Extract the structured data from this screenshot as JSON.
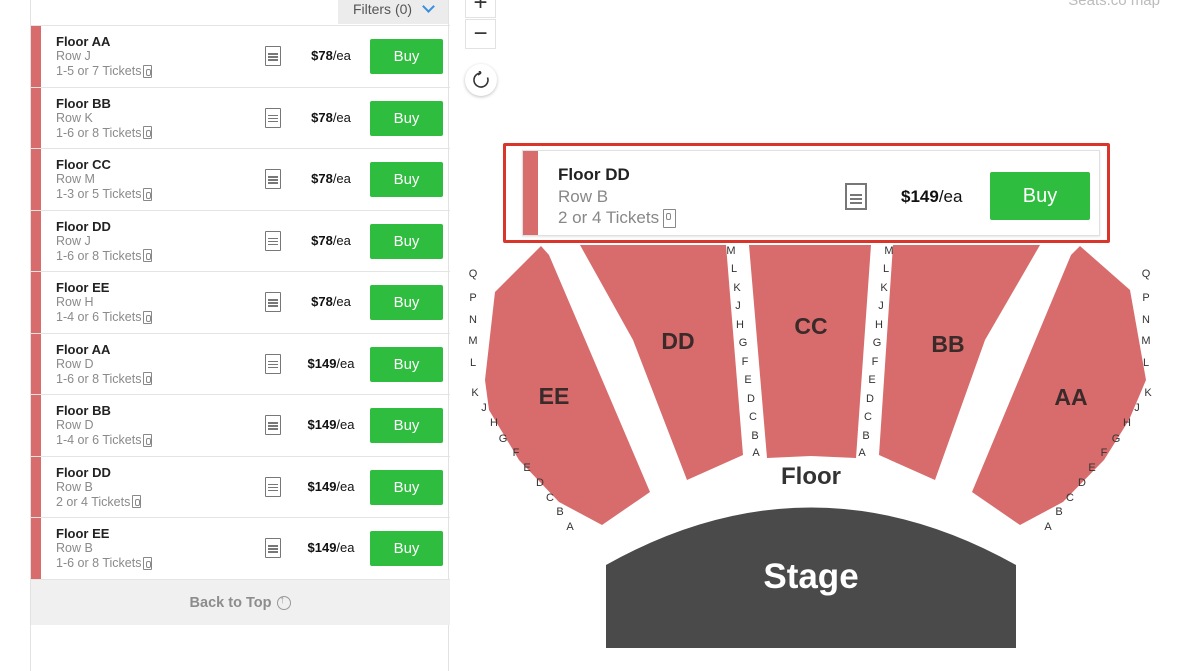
{
  "filters": {
    "label": "Filters (0)"
  },
  "listings": [
    {
      "section": "Floor AA",
      "row": "Row J",
      "tickets": "1-5 or 7 Tickets",
      "price": "$78",
      "unit": "/ea",
      "buy": "Buy"
    },
    {
      "section": "Floor BB",
      "row": "Row K",
      "tickets": "1-6 or 8 Tickets",
      "price": "$78",
      "unit": "/ea",
      "buy": "Buy"
    },
    {
      "section": "Floor CC",
      "row": "Row M",
      "tickets": "1-3 or 5 Tickets",
      "price": "$78",
      "unit": "/ea",
      "buy": "Buy"
    },
    {
      "section": "Floor DD",
      "row": "Row J",
      "tickets": "1-6 or 8 Tickets",
      "price": "$78",
      "unit": "/ea",
      "buy": "Buy"
    },
    {
      "section": "Floor EE",
      "row": "Row H",
      "tickets": "1-4 or 6 Tickets",
      "price": "$78",
      "unit": "/ea",
      "buy": "Buy"
    },
    {
      "section": "Floor AA",
      "row": "Row D",
      "tickets": "1-6 or 8 Tickets",
      "price": "$149",
      "unit": "/ea",
      "buy": "Buy"
    },
    {
      "section": "Floor BB",
      "row": "Row D",
      "tickets": "1-4 or 6 Tickets",
      "price": "$149",
      "unit": "/ea",
      "buy": "Buy"
    },
    {
      "section": "Floor DD",
      "row": "Row B",
      "tickets": "2 or 4 Tickets",
      "price": "$149",
      "unit": "/ea",
      "buy": "Buy"
    },
    {
      "section": "Floor EE",
      "row": "Row B",
      "tickets": "1-6 or 8 Tickets",
      "price": "$149",
      "unit": "/ea",
      "buy": "Buy"
    }
  ],
  "back_to_top": "Back to Top",
  "map": {
    "title": "Seats.co map",
    "zoom_in": "+",
    "zoom_out": "−",
    "sections": [
      "AA",
      "BB",
      "CC",
      "DD",
      "EE"
    ],
    "floor_label": "Floor",
    "stage_label": "Stage",
    "rows_outer": [
      "Q",
      "P",
      "N",
      "M",
      "L",
      "K",
      "J",
      "H",
      "G",
      "F",
      "E",
      "D",
      "C",
      "B",
      "A"
    ],
    "rows_inner": [
      "M",
      "L",
      "K",
      "J",
      "H",
      "G",
      "F",
      "E",
      "D",
      "C",
      "B",
      "A"
    ],
    "section_color": "#d86c6c",
    "stage_color": "#4a4a4a"
  },
  "popup": {
    "section": "Floor DD",
    "row": "Row B",
    "tickets": "2 or 4 Tickets",
    "price": "$149",
    "unit": "/ea",
    "buy": "Buy"
  }
}
